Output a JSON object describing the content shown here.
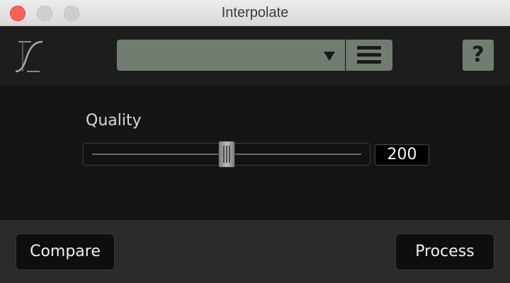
{
  "window": {
    "title": "Interpolate"
  },
  "toolbar": {
    "icon": "s-curve-icon",
    "preset": {
      "value": ""
    },
    "menu_icon": "hamburger-menu-icon",
    "help_label": "?"
  },
  "quality": {
    "label": "Quality",
    "value": "200",
    "slider_fraction": 0.5
  },
  "footer": {
    "compare_label": "Compare",
    "process_label": "Process"
  },
  "colors": {
    "close_button": "#fc5f57",
    "accent_gray_green": "#727d72",
    "panel_background": "#151515"
  }
}
